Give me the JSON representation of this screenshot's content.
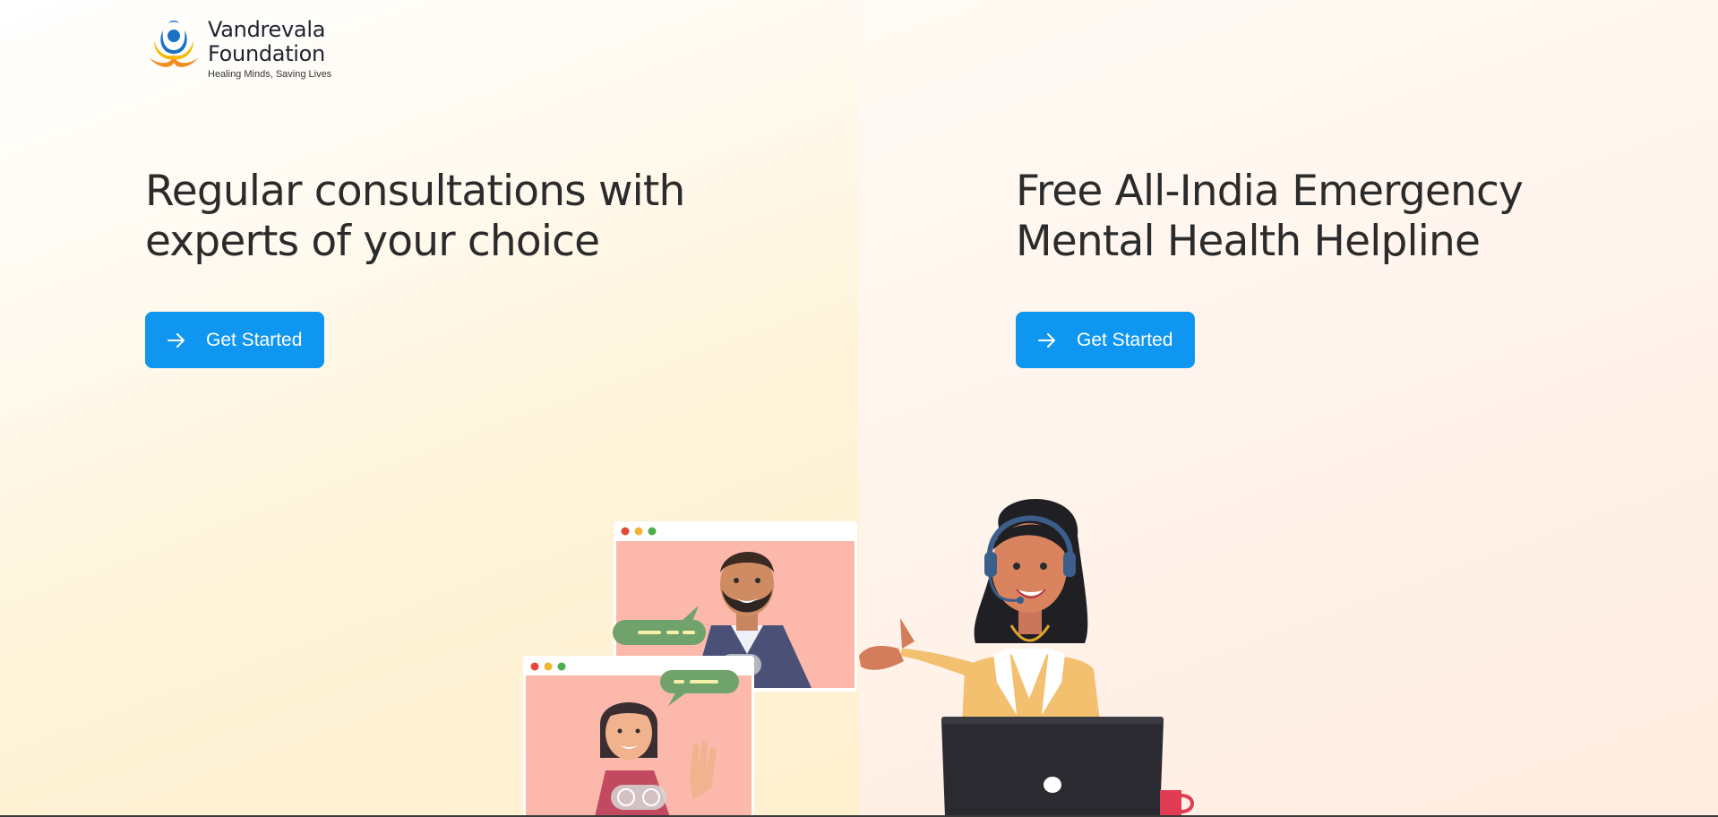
{
  "logo": {
    "name_line1": "Vandrevala",
    "name_line2": "Foundation",
    "tagline": "Healing Minds, Saving Lives"
  },
  "left": {
    "headline_line1": "Regular consultations with",
    "headline_line2": "experts of your choice",
    "cta_label": "Get Started"
  },
  "right": {
    "headline_line1": "Free All-India Emergency",
    "headline_line2": "Mental Health Helpline",
    "cta_label": "Get Started"
  },
  "colors": {
    "accent": "#0f96f0",
    "text": "#2b2b2b",
    "left_bg": "#fff4d9",
    "right_bg": "#ffece0"
  },
  "icons": [
    "logo-mark-icon",
    "arrow-right-icon",
    "video-call-illustration",
    "helpline-agent-illustration"
  ]
}
